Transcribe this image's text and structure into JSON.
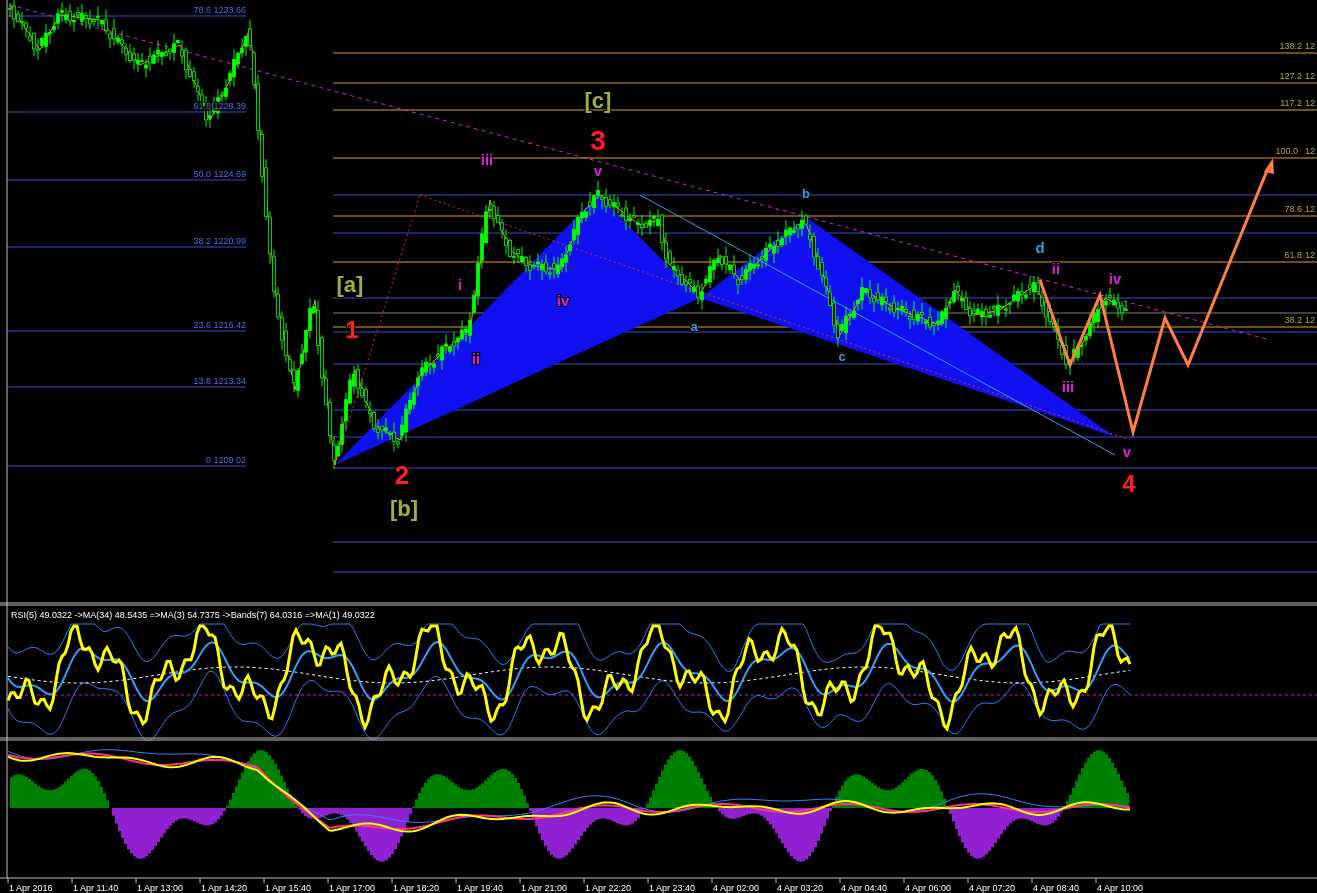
{
  "fib_left": [
    {
      "label": "78.6 1233.66"
    },
    {
      "label": "61.8 1228.39"
    },
    {
      "label": "50.0 1224.69"
    },
    {
      "label": "38.2 1220.99"
    },
    {
      "label": "23.6 1216.42"
    },
    {
      "label": "13.8 1213.34"
    },
    {
      "label": "0 1209.02"
    }
  ],
  "fib_right": [
    {
      "ratio": "138.2",
      "price": "12"
    },
    {
      "ratio": "127.2",
      "price": "12"
    },
    {
      "ratio": "117.2",
      "price": "12"
    },
    {
      "ratio": "100.0",
      "price": "12"
    },
    {
      "ratio": "78.6",
      "price": "12"
    },
    {
      "ratio": "61.8",
      "price": "12"
    },
    {
      "ratio": "38.2",
      "price": "12"
    }
  ],
  "waves": [
    {
      "text": "[a]",
      "color": "#a0b040"
    },
    {
      "text": "1",
      "color": "#ff2020"
    },
    {
      "text": "2",
      "color": "#ff2020"
    },
    {
      "text": "[b]",
      "color": "#a0b040"
    },
    {
      "text": "i",
      "color": "#e020e0"
    },
    {
      "text": "ii",
      "color": "#e020e0"
    },
    {
      "text": "iii",
      "color": "#e020e0"
    },
    {
      "text": "iv",
      "color": "#e020e0"
    },
    {
      "text": "[c]",
      "color": "#a0b040"
    },
    {
      "text": "3",
      "color": "#ff2020"
    },
    {
      "text": "v",
      "color": "#e020e0"
    },
    {
      "text": "a",
      "color": "#30a0e0"
    },
    {
      "text": "b",
      "color": "#30a0e0"
    },
    {
      "text": "c",
      "color": "#30a0e0"
    },
    {
      "text": "d",
      "color": "#30a0e0"
    },
    {
      "text": "ii",
      "color": "#e020e0"
    },
    {
      "text": "iv",
      "color": "#e020e0"
    },
    {
      "text": "iii",
      "color": "#e020e0"
    },
    {
      "text": "v",
      "color": "#e020e0"
    },
    {
      "text": "4",
      "color": "#ff2020"
    }
  ],
  "rsi_panel": {
    "legend": "RSI(5) 49.0322  ->MA(34) 48.5435  =>MA(3) 54.7375  ->Bands(7) 64.0316  =>MA(1) 49.0322"
  },
  "time_axis": [
    "1 Apr 2016",
    "1 Apr 11:40",
    "1 Apr 13:00",
    "1 Apr 14:20",
    "1 Apr 15:40",
    "1 Apr 17:00",
    "1 Apr 18:20",
    "1 Apr 19:40",
    "1 Apr 21:00",
    "1 Apr 22:20",
    "1 Apr 23:40",
    "4 Apr 02:00",
    "4 Apr 03:20",
    "4 Apr 04:40",
    "4 Apr 06:00",
    "4 Apr 07:20",
    "4 Apr 08:40",
    "4 Apr 10:00"
  ]
}
